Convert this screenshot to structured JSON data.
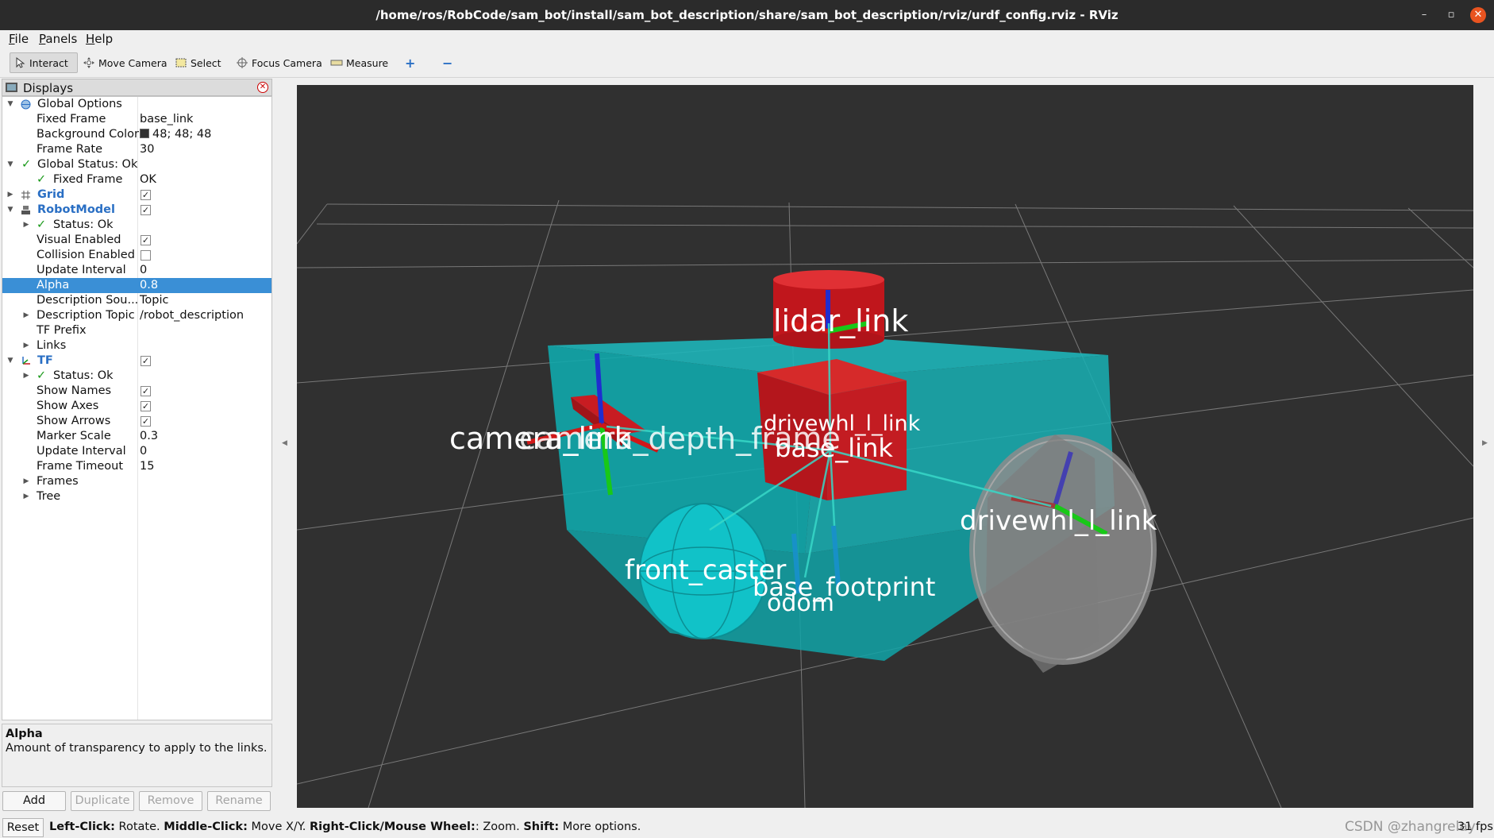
{
  "window": {
    "title": "/home/ros/RobCode/sam_bot/install/sam_bot_description/share/sam_bot_description/rviz/urdf_config.rviz - RViz",
    "min": "–",
    "max": "▫",
    "close": "✕"
  },
  "menu": {
    "file": "File",
    "panels": "Panels",
    "help": "Help"
  },
  "toolbar": {
    "interact": "Interact",
    "move_camera": "Move Camera",
    "select": "Select",
    "focus_camera": "Focus Camera",
    "measure": "Measure",
    "add_tool": "+",
    "remove_tool": "−"
  },
  "displays": {
    "title": "Displays",
    "rows": [
      {
        "name": "Global Options",
        "value": ""
      },
      {
        "name": "Fixed Frame",
        "value": "base_link"
      },
      {
        "name": "Background Color",
        "value": "48; 48; 48"
      },
      {
        "name": "Frame Rate",
        "value": "30"
      },
      {
        "name": "Global Status: Ok",
        "value": ""
      },
      {
        "name": "Fixed Frame",
        "value": "OK"
      },
      {
        "name": "Grid",
        "value": ""
      },
      {
        "name": "RobotModel",
        "value": ""
      },
      {
        "name": "Status: Ok",
        "value": ""
      },
      {
        "name": "Visual Enabled",
        "value": ""
      },
      {
        "name": "Collision Enabled",
        "value": ""
      },
      {
        "name": "Update Interval",
        "value": "0"
      },
      {
        "name": "Alpha",
        "value": "0.8"
      },
      {
        "name": "Description Sou...",
        "value": "Topic"
      },
      {
        "name": "Description Topic",
        "value": "/robot_description"
      },
      {
        "name": "TF Prefix",
        "value": ""
      },
      {
        "name": "Links",
        "value": ""
      },
      {
        "name": "TF",
        "value": ""
      },
      {
        "name": "Status: Ok",
        "value": ""
      },
      {
        "name": "Show Names",
        "value": ""
      },
      {
        "name": "Show Axes",
        "value": ""
      },
      {
        "name": "Show Arrows",
        "value": ""
      },
      {
        "name": "Marker Scale",
        "value": "0.3"
      },
      {
        "name": "Update Interval",
        "value": "0"
      },
      {
        "name": "Frame Timeout",
        "value": "15"
      },
      {
        "name": "Frames",
        "value": ""
      },
      {
        "name": "Tree",
        "value": ""
      }
    ],
    "checkbox_states": {
      "grid": true,
      "robot_model": true,
      "visual_enabled": true,
      "collision_enabled": false,
      "tf": true,
      "show_names": true,
      "show_axes": true,
      "show_arrows": true
    },
    "selected_row": "Alpha",
    "background_color_hex": "#303030"
  },
  "description": {
    "title": "Alpha",
    "text": "Amount of transparency to apply to the links."
  },
  "panel_buttons": {
    "add": "Add",
    "duplicate": "Duplicate",
    "remove": "Remove",
    "rename": "Rename"
  },
  "viewport_labels": {
    "lidar": "lidar_link",
    "camera": "camera_link",
    "camera_overlap": "camera_depth_frame",
    "drivewhl_top": "drivewhl_l_link",
    "base_link": "base_link",
    "drivewhl_right": "drivewhl_l_link",
    "front_caster": "front_caster",
    "base_footprint": "base_footprint",
    "odom": "odom"
  },
  "statusbar": {
    "reset": "Reset",
    "left_click_key": "Left-Click:",
    "left_click_val": " Rotate. ",
    "middle_click_key": "Middle-Click:",
    "middle_click_val": " Move X/Y. ",
    "right_click_key": "Right-Click/Mouse Wheel:",
    "right_click_val": ": Zoom. ",
    "shift_key": "Shift:",
    "shift_val": " More options.",
    "fps": "31 fps",
    "watermark": "CSDN @zhangrelay"
  },
  "colors": {
    "chassis": "#19b9bf",
    "link_red": "#c4161c",
    "wheel": "#8c8c8c",
    "selection": "#3a8fd6",
    "link_name": "#2a6fc4"
  }
}
